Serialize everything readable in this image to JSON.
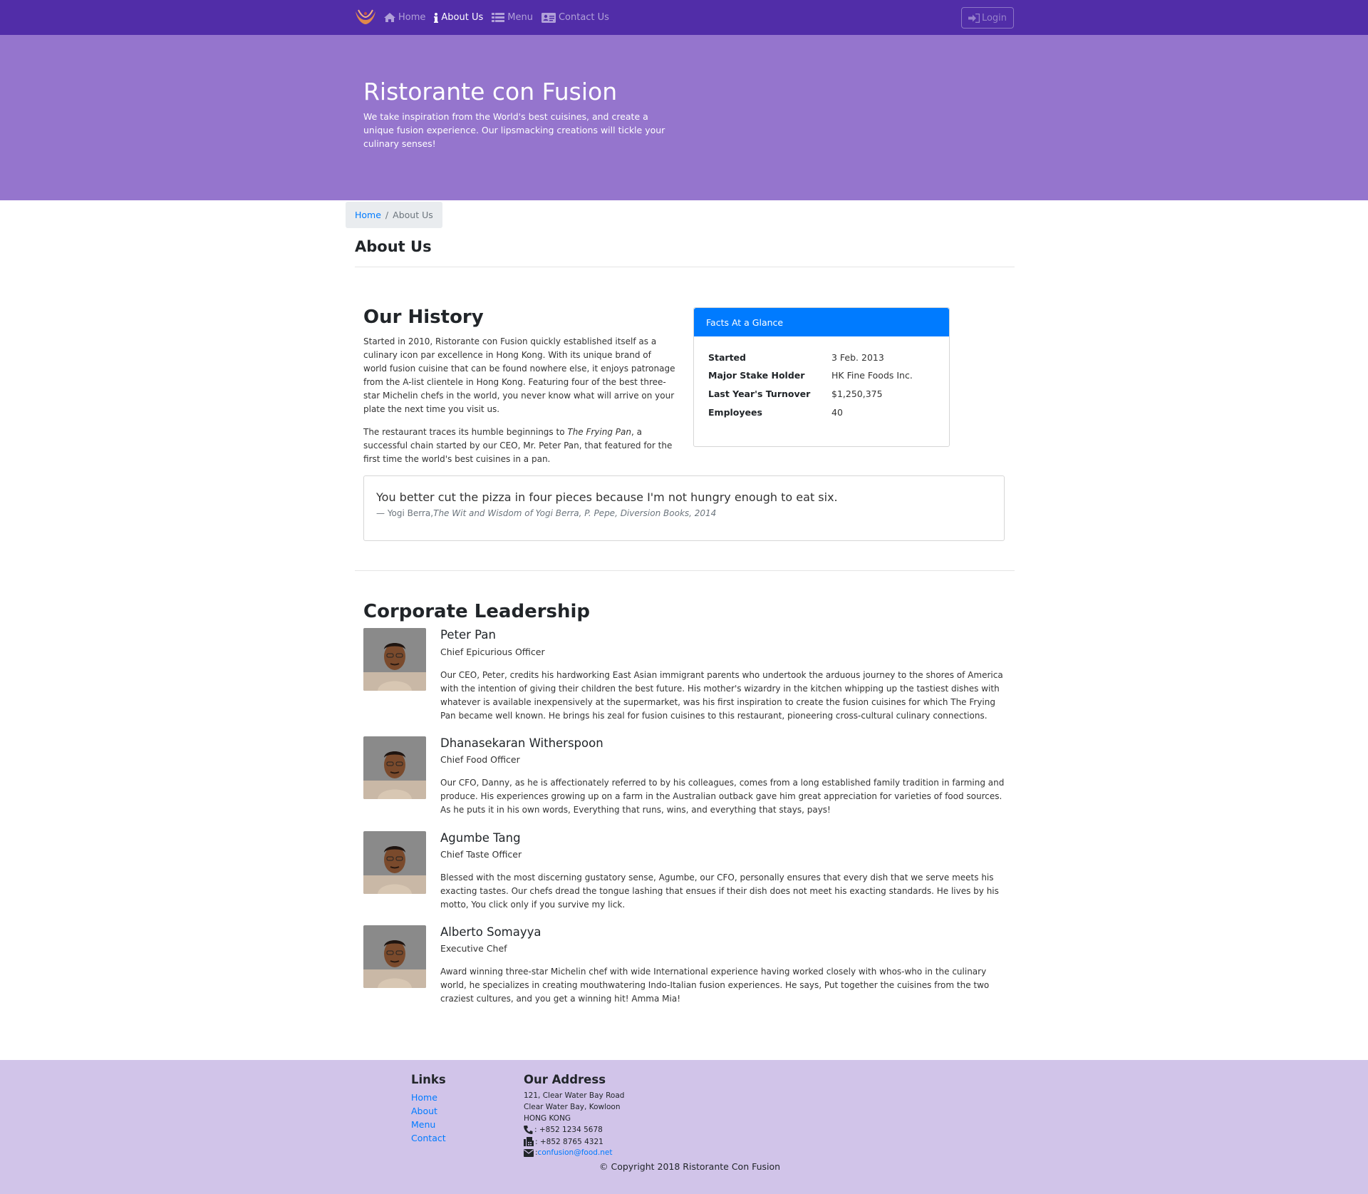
{
  "nav": {
    "items": [
      {
        "label": "Home",
        "icon": "home-icon"
      },
      {
        "label": "About Us",
        "icon": "info-icon"
      },
      {
        "label": "Menu",
        "icon": "list-icon"
      },
      {
        "label": "Contact Us",
        "icon": "address-card-icon"
      }
    ],
    "active": "About Us",
    "login_label": "Login",
    "colors": {
      "primary": "#512da8",
      "jumbotron": "#9575cd",
      "footer": "#d1c4e9",
      "accent": "#007bff"
    }
  },
  "jumbotron": {
    "title": "Ristorante con Fusion",
    "text": "We take inspiration from the World's best cuisines, and create a unique fusion experience. Our lipsmacking creations will tickle your culinary senses!"
  },
  "breadcrumb": {
    "home": "Home",
    "current": "About Us"
  },
  "page": {
    "heading": "About Us"
  },
  "history": {
    "title": "Our History",
    "p1": "Started in 2010, Ristorante con Fusion quickly established itself as a culinary icon par excellence in Hong Kong. With its unique brand of world fusion cuisine that can be found nowhere else, it enjoys patronage from the A-list clientele in Hong Kong. Featuring four of the best three-star Michelin chefs in the world, you never know what will arrive on your plate the next time you visit us.",
    "p2_before": "The restaurant traces its humble beginnings to ",
    "p2_em": "The Frying Pan",
    "p2_after": ", a successful chain started by our CEO, Mr. Peter Pan, that featured for the first time the world's best cuisines in a pan."
  },
  "facts": {
    "header": "Facts At a Glance",
    "rows": [
      {
        "key": "Started",
        "value": "3 Feb. 2013"
      },
      {
        "key": "Major Stake Holder",
        "value": "HK Fine Foods Inc."
      },
      {
        "key": "Last Year's Turnover",
        "value": "$1,250,375"
      },
      {
        "key": "Employees",
        "value": "40"
      }
    ]
  },
  "quote": {
    "text": "You better cut the pizza in four pieces because I'm not hungry enough to eat six.",
    "author": "— Yogi Berra,",
    "source": "The Wit and Wisdom of Yogi Berra, P. Pepe, Diversion Books, 2014"
  },
  "leadership": {
    "title": "Corporate Leadership",
    "leaders": [
      {
        "name": "Peter Pan",
        "role": "Chief Epicurious Officer",
        "desc": "Our CEO, Peter, credits his hardworking East Asian immigrant parents who undertook the arduous journey to the shores of America with the intention of giving their children the best future. His mother's wizardry in the kitchen whipping up the tastiest dishes with whatever is available inexpensively at the supermarket, was his first inspiration to create the fusion cuisines for which The Frying Pan became well known. He brings his zeal for fusion cuisines to this restaurant, pioneering cross-cultural culinary connections."
      },
      {
        "name": "Dhanasekaran Witherspoon",
        "role": "Chief Food Officer",
        "desc": "Our CFO, Danny, as he is affectionately referred to by his colleagues, comes from a long established family tradition in farming and produce. His experiences growing up on a farm in the Australian outback gave him great appreciation for varieties of food sources. As he puts it in his own words, Everything that runs, wins, and everything that stays, pays!"
      },
      {
        "name": "Agumbe Tang",
        "role": "Chief Taste Officer",
        "desc": "Blessed with the most discerning gustatory sense, Agumbe, our CFO, personally ensures that every dish that we serve meets his exacting tastes. Our chefs dread the tongue lashing that ensues if their dish does not meet his exacting standards. He lives by his motto, You click only if you survive my lick."
      },
      {
        "name": "Alberto Somayya",
        "role": "Executive Chef",
        "desc": "Award winning three-star Michelin chef with wide International experience having worked closely with whos-who in the culinary world, he specializes in creating mouthwatering Indo-Italian fusion experiences. He says, Put together the cuisines from the two craziest cultures, and you get a winning hit! Amma Mia!"
      }
    ]
  },
  "footer": {
    "links_title": "Links",
    "links": [
      "Home",
      "About",
      "Menu",
      "Contact"
    ],
    "address_title": "Our Address",
    "address": [
      "121, Clear Water Bay Road",
      "Clear Water Bay, Kowloon",
      "HONG KONG"
    ],
    "phone": ": +852 1234 5678",
    "fax": ": +852 8765 4321",
    "email_prefix": ": ",
    "email": "confusion@food.net",
    "copyright": "© Copyright 2018 Ristorante Con Fusion"
  }
}
